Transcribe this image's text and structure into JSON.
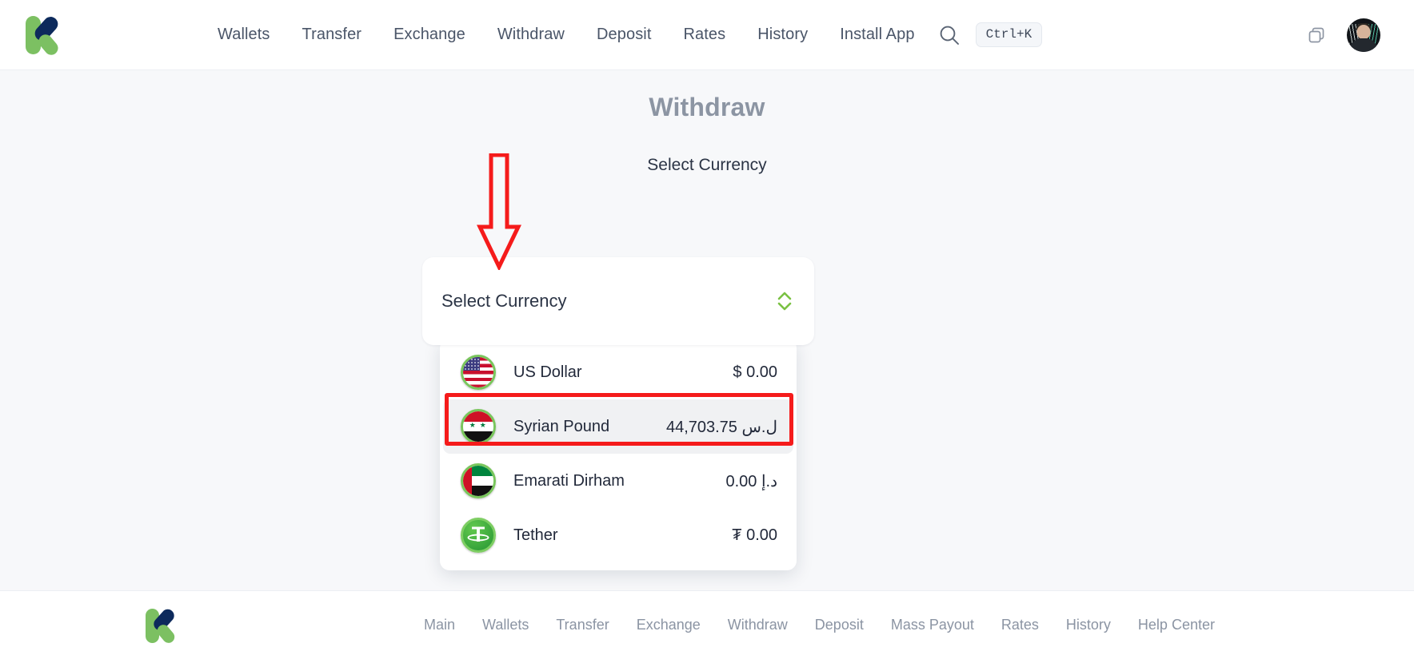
{
  "header": {
    "logo_name": "kashflow-logo",
    "nav": [
      {
        "label": "Wallets"
      },
      {
        "label": "Transfer"
      },
      {
        "label": "Exchange"
      },
      {
        "label": "Withdraw"
      },
      {
        "label": "Deposit"
      },
      {
        "label": "Rates"
      },
      {
        "label": "History"
      },
      {
        "label": "Install App"
      }
    ],
    "search": {
      "icon": "search-icon",
      "shortcut_badge": "Ctrl+K"
    },
    "copy_icon": "copy-icon",
    "avatar_alt": "user-avatar"
  },
  "main": {
    "title": "Withdraw",
    "subtitle": "Select Currency",
    "select": {
      "placeholder": "Select Currency",
      "chevron_icon": "chevron-up-down-icon",
      "chevron_color": "#7ac143"
    },
    "dropdown": {
      "options": [
        {
          "name": "US Dollar",
          "balance": "$ 0.00",
          "flag": "us-flag-icon",
          "selected": false
        },
        {
          "name": "Syrian Pound",
          "balance": "ل.س 44,703.75",
          "flag": "syria-flag-icon",
          "selected": true
        },
        {
          "name": "Emarati Dirham",
          "balance": "د.إ 0.00",
          "flag": "uae-flag-icon",
          "selected": false
        },
        {
          "name": "Tether",
          "balance": "₮ 0.00",
          "flag": "tether-icon",
          "selected": false
        }
      ]
    },
    "annotations": {
      "arrow_color": "#f51b1b",
      "highlight_color": "#f51b1b"
    }
  },
  "footer": {
    "logo_name": "kashflow-logo",
    "nav": [
      {
        "label": "Main"
      },
      {
        "label": "Wallets"
      },
      {
        "label": "Transfer"
      },
      {
        "label": "Exchange"
      },
      {
        "label": "Withdraw"
      },
      {
        "label": "Deposit"
      },
      {
        "label": "Mass Payout"
      },
      {
        "label": "Rates"
      },
      {
        "label": "History"
      },
      {
        "label": "Help Center"
      }
    ]
  }
}
